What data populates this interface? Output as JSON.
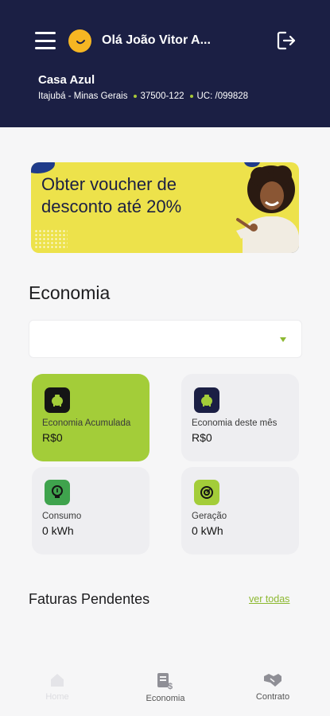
{
  "header": {
    "greeting": "Olá João Vitor A...",
    "house_name": "Casa Azul",
    "city": "Itajubá - Minas Gerais",
    "cep": "37500-122",
    "uc": "UC: /099828"
  },
  "banner": {
    "line1": "Obter voucher de",
    "line2": "desconto até 20%"
  },
  "economia": {
    "title": "Economia",
    "select_value": "",
    "cards": [
      {
        "label": "Economia Acumulada",
        "value": "R$0",
        "icon": "piggy-bank-icon"
      },
      {
        "label": "Economia deste mês",
        "value": "R$0",
        "icon": "piggy-bank-icon"
      },
      {
        "label": "Consumo",
        "value": "0 kWh",
        "icon": "lightbulb-icon"
      },
      {
        "label": "Geração",
        "value": "0 kWh",
        "icon": "solar-gauge-icon"
      }
    ]
  },
  "faturas": {
    "title": "Faturas Pendentes",
    "link": "ver todas"
  },
  "nav": {
    "items": [
      {
        "label": "Home",
        "icon": "home-icon"
      },
      {
        "label": "Economia",
        "icon": "invoice-icon"
      },
      {
        "label": "Contrato",
        "icon": "handshake-icon"
      }
    ]
  },
  "colors": {
    "header_bg": "#1b1f44",
    "accent_green": "#a3cd39",
    "banner_yellow": "#ede24b",
    "avatar_yellow": "#f6b623"
  }
}
